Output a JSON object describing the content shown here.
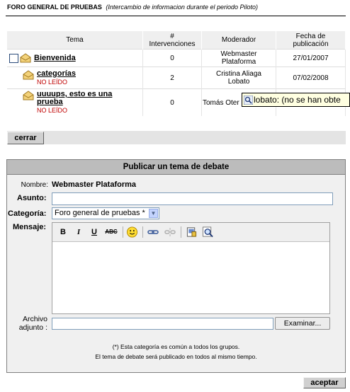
{
  "header": {
    "forum_name": "FORO GENERAL DE PRUEBAS",
    "forum_desc": "(Intercambio de informacion durante el periodo Piloto)"
  },
  "table": {
    "col_tema": "Tema",
    "col_hash": "#",
    "col_interv": "Intervenciones",
    "col_moderador": "Moderador",
    "col_fecha1": "Fecha de",
    "col_fecha2": "publicación",
    "rows": [
      {
        "tema": "Bienvenida",
        "unread": "",
        "intervenciones": "0",
        "mod1": "Webmaster",
        "mod2": "Plataforma",
        "fecha": "27/01/2007"
      },
      {
        "tema": "categorías",
        "unread": "NO LEÍDO",
        "intervenciones": "2",
        "mod1": "Cristina Aliaga",
        "mod2": "Lobato",
        "fecha": "07/02/2008"
      },
      {
        "tema1": "uuuups, esto es una",
        "tema2": "prueba",
        "unread": "NO LEÍDO",
        "intervenciones": "0",
        "mod1": "Tomás Oter",
        "mod2": "",
        "fecha": ""
      }
    ]
  },
  "tooltip": {
    "text": "lobato: (no se han obte"
  },
  "buttons": {
    "cerrar": "cerrar",
    "examinar": "Examinar...",
    "aceptar": "aceptar"
  },
  "form": {
    "title": "Publicar un tema de debate",
    "nombre_label": "Nombre:",
    "nombre_value": "Webmaster Plataforma",
    "asunto_label": "Asunto:",
    "asunto_value": "",
    "categoria_label": "Categoría:",
    "categoria_value": "Foro general de pruebas *",
    "mensaje_label": "Mensaje:",
    "archivo_label1": "Archivo",
    "archivo_label2": "adjunto :",
    "note1": "(*) Esta categoría es común a todos los grupos.",
    "note2": "El tema de debate será publicado en todos al mismo tiempo."
  },
  "editor_toolbar": {
    "bold": "B",
    "italic": "I",
    "underline": "U",
    "strike": "ABC"
  },
  "colors": {
    "unread": "#c00000",
    "header_bg": "#efefef",
    "panel_title_bg": "#bcbcbc"
  }
}
